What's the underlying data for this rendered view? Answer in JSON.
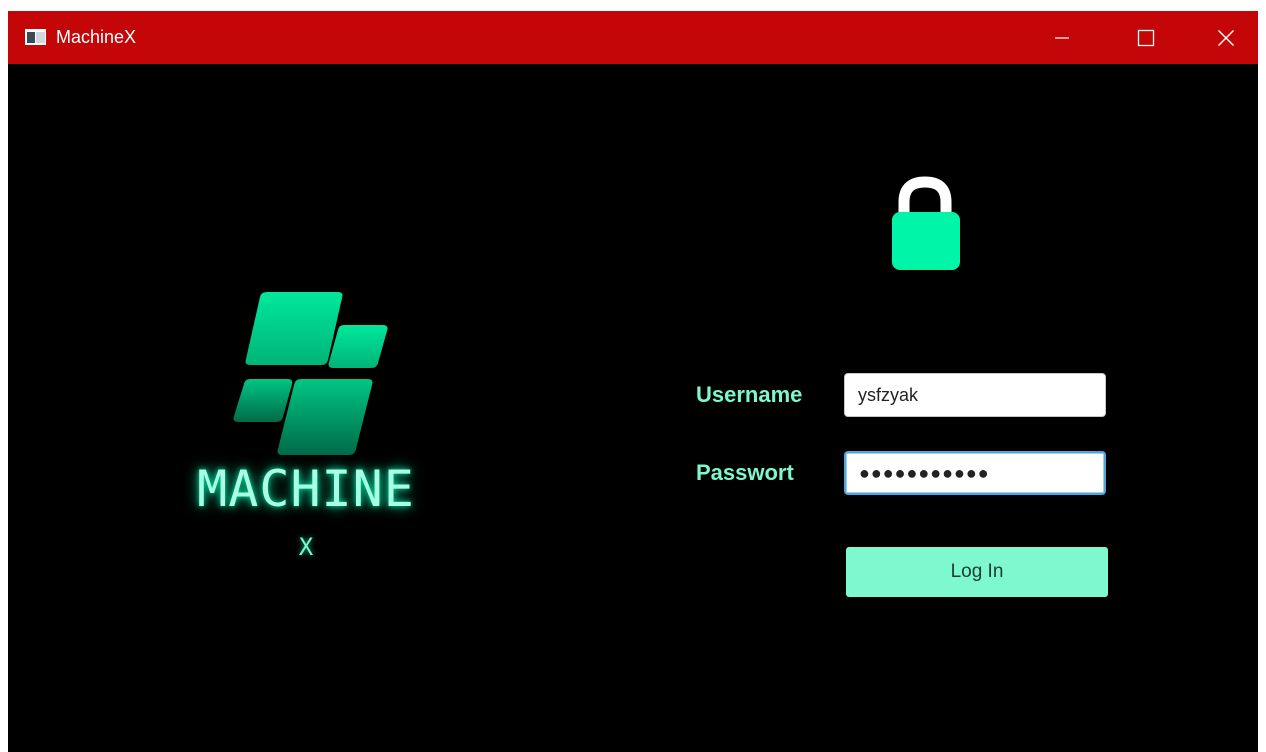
{
  "window": {
    "title": "MachineX",
    "controls": {
      "minimize": "minimize-icon",
      "maximize": "maximize-icon",
      "close": "close-icon"
    }
  },
  "brand": {
    "word": "MACHINE",
    "suffix": "X"
  },
  "form": {
    "username_label": "Username",
    "username_value": "ysfzyak",
    "password_label": "Passwort",
    "password_masked": "●●●●●●●●●●●",
    "login_label": "Log In"
  },
  "colors": {
    "titlebar": "#c40608",
    "background": "#000000",
    "accent": "#7ef9cf",
    "lock": "#00f5a8",
    "label": "#7df8cc"
  }
}
